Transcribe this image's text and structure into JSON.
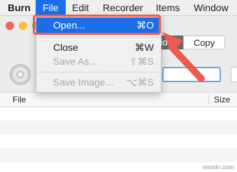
{
  "menubar": {
    "items": [
      "Burn",
      "File",
      "Edit",
      "Recorder",
      "Items",
      "Window"
    ]
  },
  "file_menu": {
    "items": [
      {
        "label": "Open...",
        "shortcut": "⌘O"
      },
      {
        "label": "Close",
        "shortcut": "⌘W"
      },
      {
        "label": "Save As...",
        "shortcut": "⇧⌘S"
      },
      {
        "label": "Save Image...",
        "shortcut": "⌥⌘S"
      }
    ]
  },
  "toolbar": {
    "tab_video_partial": "ideo",
    "tab_copy": "Copy"
  },
  "table": {
    "columns": [
      "File",
      "Size"
    ]
  },
  "watermark": "wsxdn.com",
  "colors": {
    "selection": "#1a6fe8",
    "annotation": "#ef5a4e"
  }
}
